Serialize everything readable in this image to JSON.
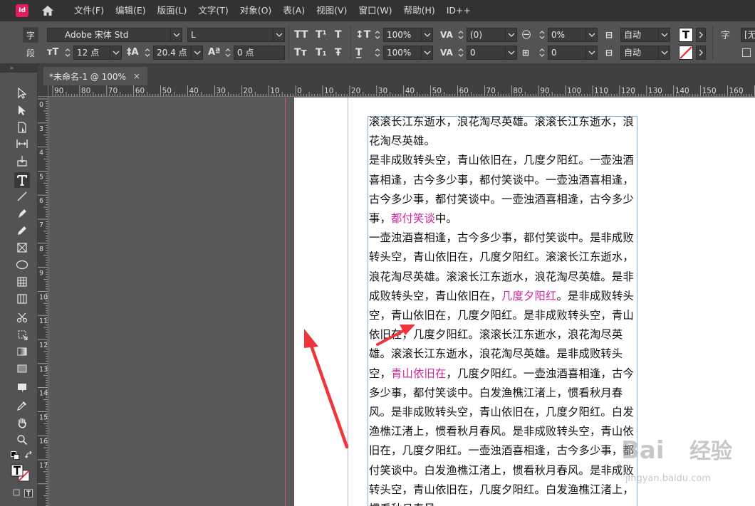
{
  "app": {
    "logo_text": "Id"
  },
  "menu": [
    "文件(F)",
    "编辑(E)",
    "版面(L)",
    "文字(T)",
    "对象(O)",
    "表(A)",
    "视图(V)",
    "窗口(W)",
    "帮助(H)",
    "ID++"
  ],
  "control": {
    "tab_char": "字",
    "tab_para": "段",
    "font_family": "Adobe 宋体 Std",
    "font_style": "L",
    "font_size": "12 点",
    "leading": "20.4 点",
    "baseline_shift": "0 点",
    "vertical_scale": "100%",
    "horizontal_scale": "100%",
    "kerning": "(0)",
    "tracking": "0",
    "tsume": "0%",
    "aki": "0",
    "align_top": "自动",
    "align_bottom": "自动",
    "right_char": "字",
    "right_field": "[无"
  },
  "tools_head": "»",
  "document": {
    "tab_title": "*未命名-1 @ 100%",
    "close_glyph": "×"
  },
  "ruler": {
    "h_labels": [
      "90",
      "80",
      "70",
      "60",
      "50",
      "40",
      "30",
      "20",
      "10",
      "0",
      "10",
      "20",
      "30",
      "40",
      "50",
      "60",
      "70",
      "80",
      "90",
      "100",
      "110",
      "120",
      "130",
      "140",
      "150",
      "160"
    ],
    "v_labels": [
      "0",
      "3",
      "4",
      "5",
      "6",
      "7",
      "8",
      "9",
      "10",
      "11",
      "12",
      "13",
      "14",
      "15",
      "16",
      "17"
    ]
  },
  "story": {
    "p1": "滚滚长江东逝水，浪花淘尽英雄。滚滚长江东逝水，浪花淘尽英雄。",
    "p2_a": "是非成败转头空，青山依旧在，几度夕阳红。一壶浊酒喜相逢，古今多少事，都付笑谈中。一壶浊酒喜相逢，古今多少事，都付笑谈中。一壶浊酒喜相逢，古今多少事，",
    "p2_hl": "都付笑谈",
    "p2_b": "中。",
    "p3_a": "一壶浊酒喜相逢，古今多少事，都付笑谈中。是非成败转头空，青山依旧在，几度夕阳红。滚滚长江东逝水，浪花淘尽英雄。滚滚长江东逝水，浪花淘尽英雄。是非成败转头空，青山依旧在，",
    "p3_hl1": "几度夕阳红",
    "p3_b": "。是非成败转头空，青山依旧在，几度夕阳红。是非成败转头空，青山依旧在，几度夕阳红。滚滚长江东逝水，浪花淘尽英雄。滚滚长江东逝水，浪花淘尽英雄。是非成败转头空，",
    "p3_hl2": "青山依旧在",
    "p3_c": "，几度夕阳红。一壶浊酒喜相逢，古今多少事，都付笑谈中。白发渔樵江渚上，惯看秋月春风。是非成败转头空，青山依旧在，几度夕阳红。白发渔樵江渚上，惯看秋月春风。是非成败转头空，青山依旧在，几度夕阳红。一壶浊酒喜相逢，古今多少事，都付笑谈中。白发渔樵江渚上，惯看秋月春风。是非成败转头空，青山依旧在，几度夕阳红。白发渔樵江渚上，惯看秋月春风。"
  },
  "colors": {
    "highlight": "#d0289c",
    "arrow": "#f0343c",
    "bleed": "#d4506e",
    "frame": "#7fb3d8"
  },
  "watermark": {
    "brand": "Bai",
    "brand_cn": "经验",
    "url": "jingyan.baidu.com"
  }
}
